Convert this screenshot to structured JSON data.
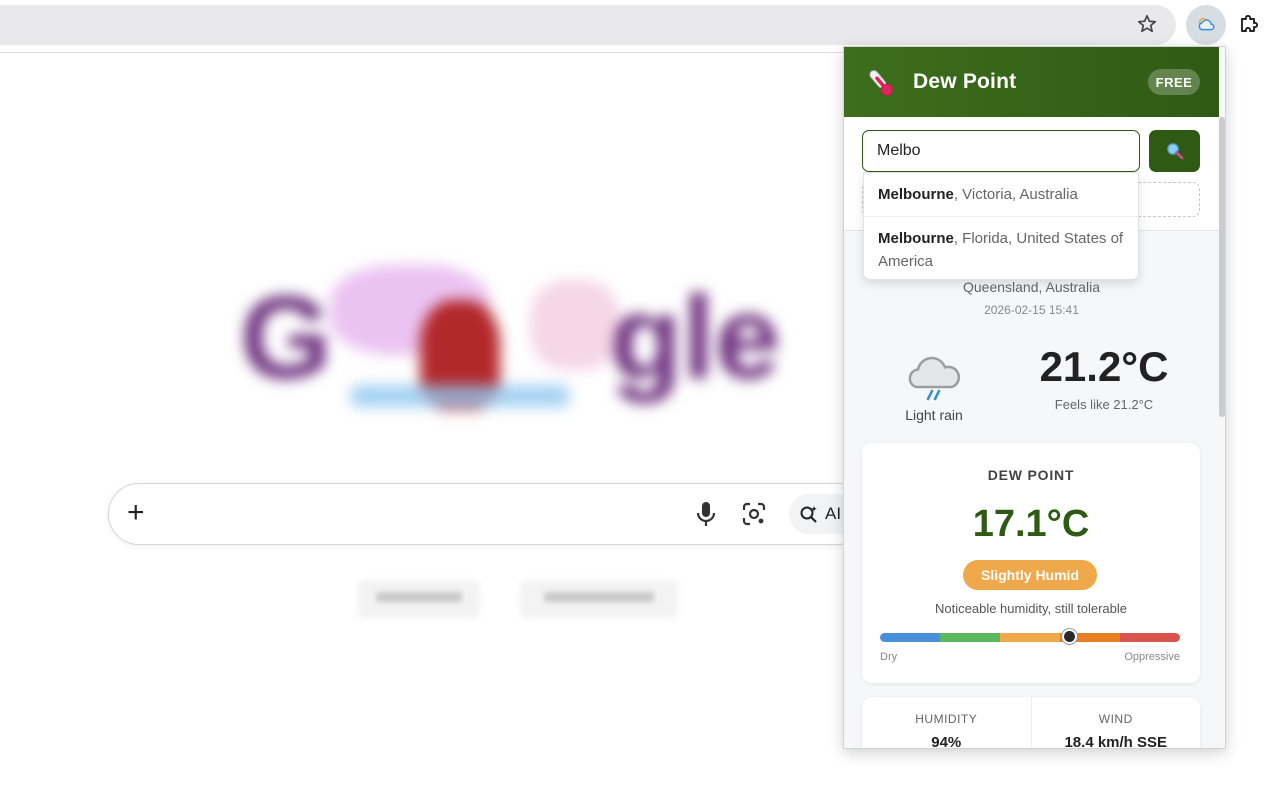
{
  "browser": {
    "icons": [
      "star-icon",
      "weather-extension-icon",
      "puzzle-icon"
    ]
  },
  "google": {
    "ai_label": "AI",
    "icons": [
      "plus-icon",
      "mic-icon",
      "lens-icon",
      "ai-search-icon"
    ]
  },
  "popup": {
    "title": "Dew Point",
    "badge": "FREE",
    "search": {
      "value": "Melbo",
      "suggestions": [
        {
          "name": "Melbourne",
          "detail": ", Victoria, Australia"
        },
        {
          "name": "Melbourne",
          "detail": ", Florida, United States of America"
        }
      ]
    },
    "location": {
      "region": "Queensland, Australia",
      "time": "2026-02-15 15:41"
    },
    "weather": {
      "condition": "Light rain",
      "temperature": "21.2°C",
      "feels_like": "Feels like 21.2°C"
    },
    "dew": {
      "label": "DEW POINT",
      "value": "17.1°C",
      "comfort": "Slightly Humid",
      "description": "Noticeable humidity, still tolerable",
      "scale_min_label": "Dry",
      "scale_max_label": "Oppressive",
      "scale_position": 0.63,
      "scale_colors": [
        "#4a90d9",
        "#5cb85c",
        "#efa94a",
        "#e67e22",
        "#d9534f"
      ]
    },
    "stats": [
      {
        "label": "HUMIDITY",
        "value": "94%"
      },
      {
        "label": "WIND",
        "value": "18.4 km/h SSE"
      }
    ],
    "colors": {
      "header": "#2f5a14",
      "accent": "#efa94a"
    }
  }
}
